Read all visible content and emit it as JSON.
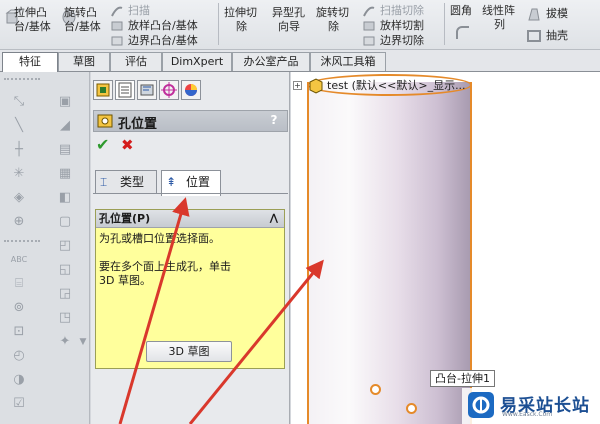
{
  "ribbon": {
    "items": [
      {
        "name": "extruded-boss",
        "lines": [
          "拉伸凸",
          "台/基体"
        ]
      },
      {
        "name": "revolved-boss",
        "lines": [
          "旋转凸",
          "台/基体"
        ]
      },
      {
        "name": "swept-boss",
        "lines": [
          "扫描"
        ]
      },
      {
        "name": "lofted-boss",
        "lines": [
          "放样凸台/基体"
        ]
      },
      {
        "name": "boundary-boss",
        "lines": [
          "边界凸台/基体"
        ]
      },
      {
        "name": "extruded-cut",
        "lines": [
          "拉伸切",
          "除"
        ]
      },
      {
        "name": "hole-wizard",
        "lines": [
          "异型孔",
          "向导"
        ]
      },
      {
        "name": "revolved-cut",
        "lines": [
          "旋转切",
          "除"
        ]
      },
      {
        "name": "swept-cut",
        "lines": [
          "扫描切除"
        ]
      },
      {
        "name": "lofted-cut",
        "lines": [
          "放样切割"
        ]
      },
      {
        "name": "boundary-cut",
        "lines": [
          "边界切除"
        ]
      },
      {
        "name": "fillet",
        "lines": [
          "圆角"
        ]
      },
      {
        "name": "linear-pattern",
        "lines": [
          "线性阵",
          "列"
        ]
      },
      {
        "name": "draft",
        "lines": [
          "拔模"
        ]
      },
      {
        "name": "shell",
        "lines": [
          "抽壳"
        ]
      }
    ]
  },
  "tabs": [
    {
      "label": "特征",
      "active": true
    },
    {
      "label": "草图",
      "active": false
    },
    {
      "label": "评估",
      "active": false
    },
    {
      "label": "DimXpert",
      "active": false
    },
    {
      "label": "办公室产品",
      "active": false
    },
    {
      "label": "沐风工具箱",
      "active": false
    }
  ],
  "property_manager": {
    "title": "孔位置",
    "help_label": "?",
    "ok_icon": "check-icon",
    "cancel_icon": "x-icon",
    "subtabs": [
      {
        "label": "类型",
        "active": false
      },
      {
        "label": "位置",
        "active": true
      }
    ],
    "group": {
      "title": "孔位置(P)",
      "line1": "为孔或槽口位置选择面。",
      "line2": "要在多个面上生成孔，单击",
      "line3": "3D 草图。",
      "button_label": "3D 草图"
    }
  },
  "graphics": {
    "tree_label": "test  (默认<<默认>_显示...",
    "tooltip": "凸台-拉伸1",
    "edge_color": "#e58a2a"
  },
  "watermark": {
    "text": "易采站长站",
    "sub": "Www.Easck.Com"
  },
  "colors": {
    "arrow": "#d9382c",
    "help_bg": "#ffff9c"
  }
}
